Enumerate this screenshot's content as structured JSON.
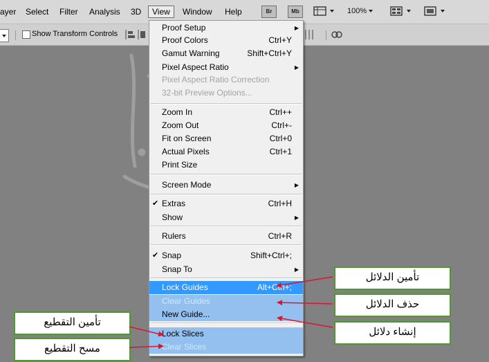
{
  "menubar": {
    "items": [
      "ayer",
      "Select",
      "Filter",
      "Analysis",
      "3D",
      "View",
      "Window",
      "Help"
    ],
    "bridge_icon": "Br",
    "minibridge_icon": "Mb",
    "zoom": "100%"
  },
  "options_bar": {
    "show_transform_controls": "Show Transform Controls"
  },
  "view_menu": {
    "proof_setup": "Proof Setup",
    "proof_colors": "Proof Colors",
    "proof_colors_sc": "Ctrl+Y",
    "gamut_warning": "Gamut Warning",
    "gamut_warning_sc": "Shift+Ctrl+Y",
    "pixel_aspect_ratio": "Pixel Aspect Ratio",
    "pixel_aspect_correction": "Pixel Aspect Ratio Correction",
    "preview_32bit": "32-bit Preview Options...",
    "zoom_in": "Zoom In",
    "zoom_in_sc": "Ctrl++",
    "zoom_out": "Zoom Out",
    "zoom_out_sc": "Ctrl+-",
    "fit_on_screen": "Fit on Screen",
    "fit_on_screen_sc": "Ctrl+0",
    "actual_pixels": "Actual Pixels",
    "actual_pixels_sc": "Ctrl+1",
    "print_size": "Print Size",
    "screen_mode": "Screen Mode",
    "extras": "Extras",
    "extras_sc": "Ctrl+H",
    "show": "Show",
    "rulers": "Rulers",
    "rulers_sc": "Ctrl+R",
    "snap": "Snap",
    "snap_sc": "Shift+Ctrl+;",
    "snap_to": "Snap To",
    "lock_guides": "Lock Guides",
    "lock_guides_sc": "Alt+Ctrl+;",
    "clear_guides": "Clear Guides",
    "new_guide": "New Guide...",
    "lock_slices": "Lock Slices",
    "clear_slices": "Clear Slices"
  },
  "callouts": {
    "lock_guides": "تأمين الدلائل",
    "clear_guides": "حذف الدلائل",
    "new_guide": "إنشاء دلائل",
    "lock_slices": "تأمين التقطيع",
    "clear_slices": "مسح التقطيع"
  },
  "colors": {
    "highlight": "#3399ff",
    "callout_border": "#4d9a2c",
    "arrow": "#d8162e"
  }
}
